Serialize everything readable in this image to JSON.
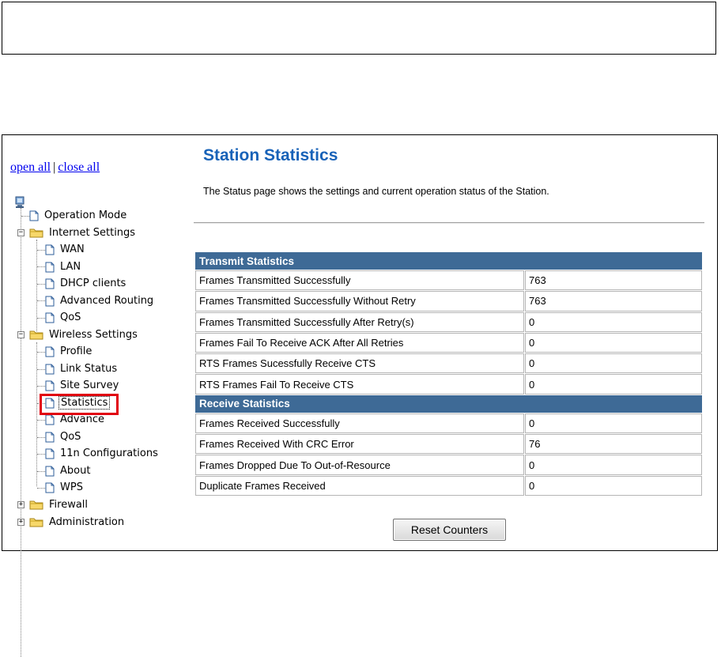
{
  "sidebar": {
    "open_all": "open all",
    "separator": "|",
    "close_all": "close all",
    "tree": {
      "operation_mode": "Operation Mode",
      "internet_settings": "Internet Settings",
      "wan": "WAN",
      "lan": "LAN",
      "dhcp_clients": "DHCP clients",
      "advanced_routing": "Advanced Routing",
      "internet_qos": "QoS",
      "wireless_settings": "Wireless Settings",
      "profile": "Profile",
      "link_status": "Link Status",
      "site_survey": "Site Survey",
      "statistics": "Statistics",
      "advance": "Advance",
      "wireless_qos": "QoS",
      "n11_configurations": "11n Configurations",
      "about": "About",
      "wps": "WPS",
      "firewall": "Firewall",
      "administration": "Administration"
    },
    "icons": {
      "root": "computer-icon",
      "page": "page-icon",
      "folder": "folder-icon"
    },
    "highlight_color": "#e1000f"
  },
  "main": {
    "title": "Station Statistics",
    "description": "The Status page shows the settings and current operation status of the Station.",
    "title_color": "#1862b8",
    "header_color": "#3e6a96",
    "transmit": {
      "header": "Transmit Statistics",
      "rows": [
        {
          "label": "Frames Transmitted Successfully",
          "value": "763"
        },
        {
          "label": "Frames Transmitted Successfully Without Retry",
          "value": "763"
        },
        {
          "label": "Frames Transmitted Successfully After Retry(s)",
          "value": "0"
        },
        {
          "label": "Frames Fail To Receive ACK After All Retries",
          "value": "0"
        },
        {
          "label": "RTS Frames Sucessfully Receive CTS",
          "value": "0"
        },
        {
          "label": "RTS Frames Fail To Receive CTS",
          "value": "0"
        }
      ]
    },
    "receive": {
      "header": "Receive Statistics",
      "rows": [
        {
          "label": "Frames Received Successfully",
          "value": "0"
        },
        {
          "label": "Frames Received With CRC Error",
          "value": "76"
        },
        {
          "label": "Frames Dropped Due To Out-of-Resource",
          "value": "0"
        },
        {
          "label": "Duplicate Frames Received",
          "value": "0"
        }
      ]
    },
    "reset_button": "Reset Counters"
  }
}
